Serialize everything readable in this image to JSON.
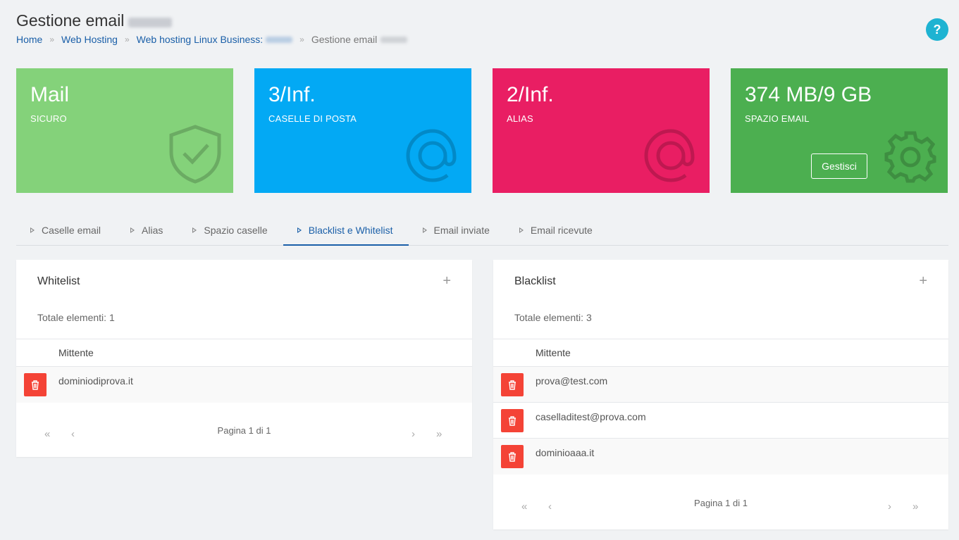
{
  "header": {
    "title": "Gestione email",
    "help_label": "?"
  },
  "breadcrumb": {
    "items": [
      "Home",
      "Web Hosting",
      "Web hosting Linux Business:"
    ],
    "current": "Gestione email",
    "separator": "»"
  },
  "cards": [
    {
      "value": "Mail",
      "label": "SICURO",
      "icon": "shield-check-icon",
      "color": "#84d27a"
    },
    {
      "value": "3/Inf.",
      "label": "CASELLE DI POSTA",
      "icon": "at-icon",
      "color": "#03a9f4"
    },
    {
      "value": "2/Inf.",
      "label": "ALIAS",
      "icon": "at-icon",
      "color": "#e91e63"
    },
    {
      "value": "374 MB/9 GB",
      "label": "SPAZIO EMAIL",
      "icon": "gear-icon",
      "color": "#4caf50",
      "button": "Gestisci"
    }
  ],
  "tabs": [
    "Caselle email",
    "Alias",
    "Spazio caselle",
    "Blacklist e Whitelist",
    "Email inviate",
    "Email ricevute"
  ],
  "active_tab": "Blacklist e Whitelist",
  "whitelist": {
    "title": "Whitelist",
    "add_label": "+",
    "total": "Totale elementi: 1",
    "column": "Mittente",
    "rows": [
      "dominiodiprova.it"
    ],
    "pager": {
      "info": "Pagina 1 di 1",
      "first": "«",
      "prev": "‹",
      "next": "›",
      "last": "»"
    }
  },
  "blacklist": {
    "title": "Blacklist",
    "add_label": "+",
    "total": "Totale elementi: 3",
    "column": "Mittente",
    "rows": [
      "prova@test.com",
      "caselladitest@prova.com",
      "dominioaaa.it"
    ],
    "pager": {
      "info": "Pagina 1 di 1",
      "first": "«",
      "prev": "‹",
      "next": "›",
      "last": "»"
    }
  }
}
